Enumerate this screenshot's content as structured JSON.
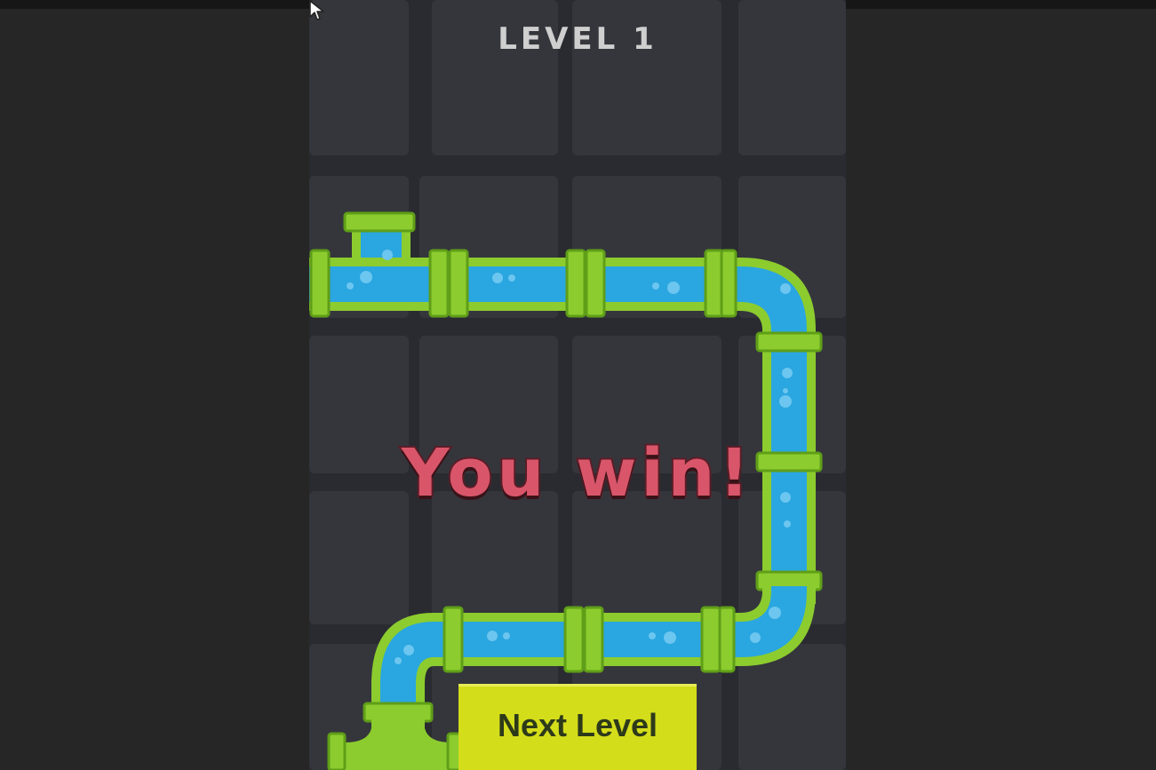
{
  "game": {
    "level_title": "LEVEL 1",
    "result_text": "You win!",
    "next_button_label": "Next Level"
  },
  "colors": {
    "background": "#2a2b30",
    "grid_line": "#1c1d21",
    "pipe_green": "#8ccc2e",
    "pipe_green_dark": "#5f9e18",
    "water_blue": "#2aa6e0",
    "win_text": "#d9566a",
    "button_yellow": "#d4dd1a"
  },
  "icons": {
    "pointer": "mouse-pointer-icon"
  }
}
